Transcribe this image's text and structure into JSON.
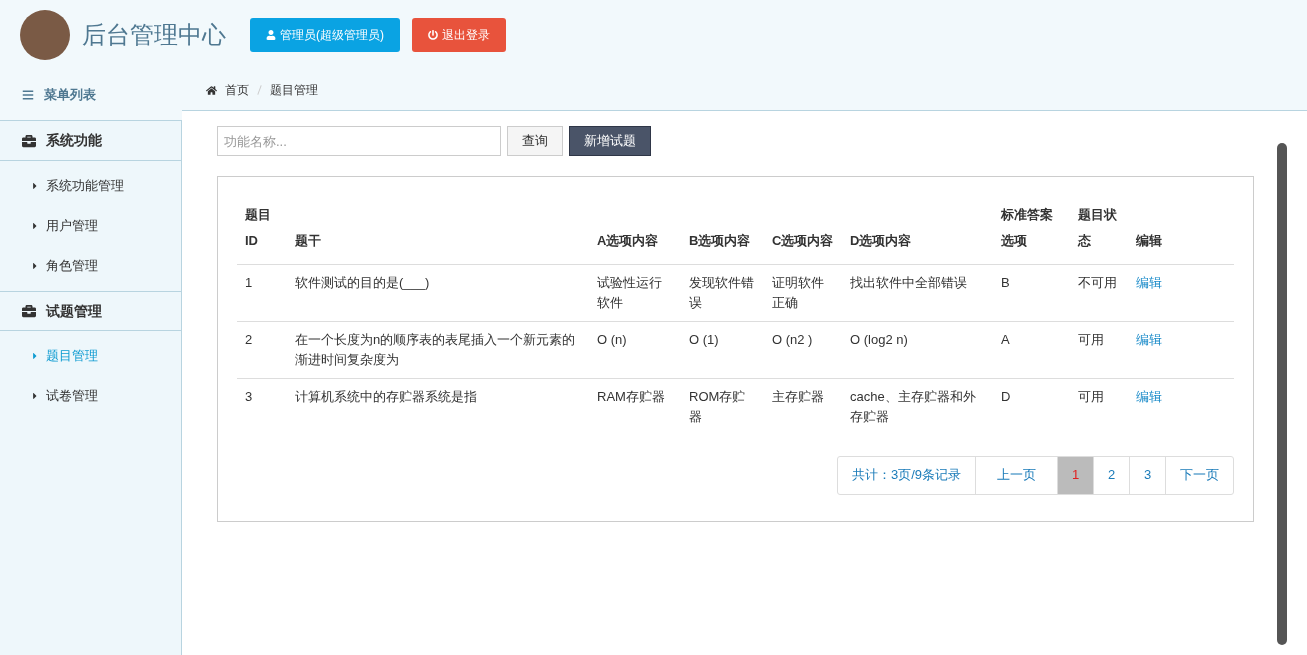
{
  "header": {
    "title": "后台管理中心",
    "user_button": "管理员(超级管理员)",
    "logout_button": "退出登录"
  },
  "sidebar": {
    "heading": "菜单列表",
    "groups": [
      {
        "label": "系统功能",
        "items": [
          {
            "label": "系统功能管理",
            "selected": false
          },
          {
            "label": "用户管理",
            "selected": false
          },
          {
            "label": "角色管理",
            "selected": false
          }
        ]
      },
      {
        "label": "试题管理",
        "items": [
          {
            "label": "题目管理",
            "selected": true
          },
          {
            "label": "试卷管理",
            "selected": false
          }
        ]
      }
    ]
  },
  "breadcrumb": [
    "首页",
    "题目管理"
  ],
  "search": {
    "placeholder": "功能名称...",
    "query_button": "查询",
    "add_button": "新增试题"
  },
  "table": {
    "columns": [
      "题目ID",
      "题干",
      "A选项内容",
      "B选项内容",
      "C选项内容",
      "D选项内容",
      "标准答案选项",
      "题目状态",
      "编辑"
    ],
    "rows": [
      {
        "id": "1",
        "stem": "软件测试的目的是(___)",
        "a": "试验性运行软件",
        "b": "发现软件错误",
        "c": "证明软件正确",
        "d": "找出软件中全部错误",
        "answer": "B",
        "status": "不可用",
        "edit": "编辑"
      },
      {
        "id": "2",
        "stem": "在一个长度为n的顺序表的表尾插入一个新元素的渐进时间复杂度为",
        "a": "O (n)",
        "b": "O (1)",
        "c": "O (n2 )",
        "d": "O (log2 n)",
        "answer": "A",
        "status": "可用",
        "edit": "编辑"
      },
      {
        "id": "3",
        "stem": "计算机系统中的存贮器系统是指",
        "a": "RAM存贮器",
        "b": "ROM存贮器",
        "c": "主存贮器",
        "d": "cache、主存贮器和外存贮器",
        "answer": "D",
        "status": "可用",
        "edit": "编辑"
      }
    ]
  },
  "pagination": {
    "summary": "共计：3页/9条记录",
    "prev": "上一页",
    "pages": [
      {
        "label": "1",
        "selected": true
      },
      {
        "label": "2",
        "selected": false
      },
      {
        "label": "3",
        "selected": false
      }
    ],
    "next": "下一页"
  }
}
